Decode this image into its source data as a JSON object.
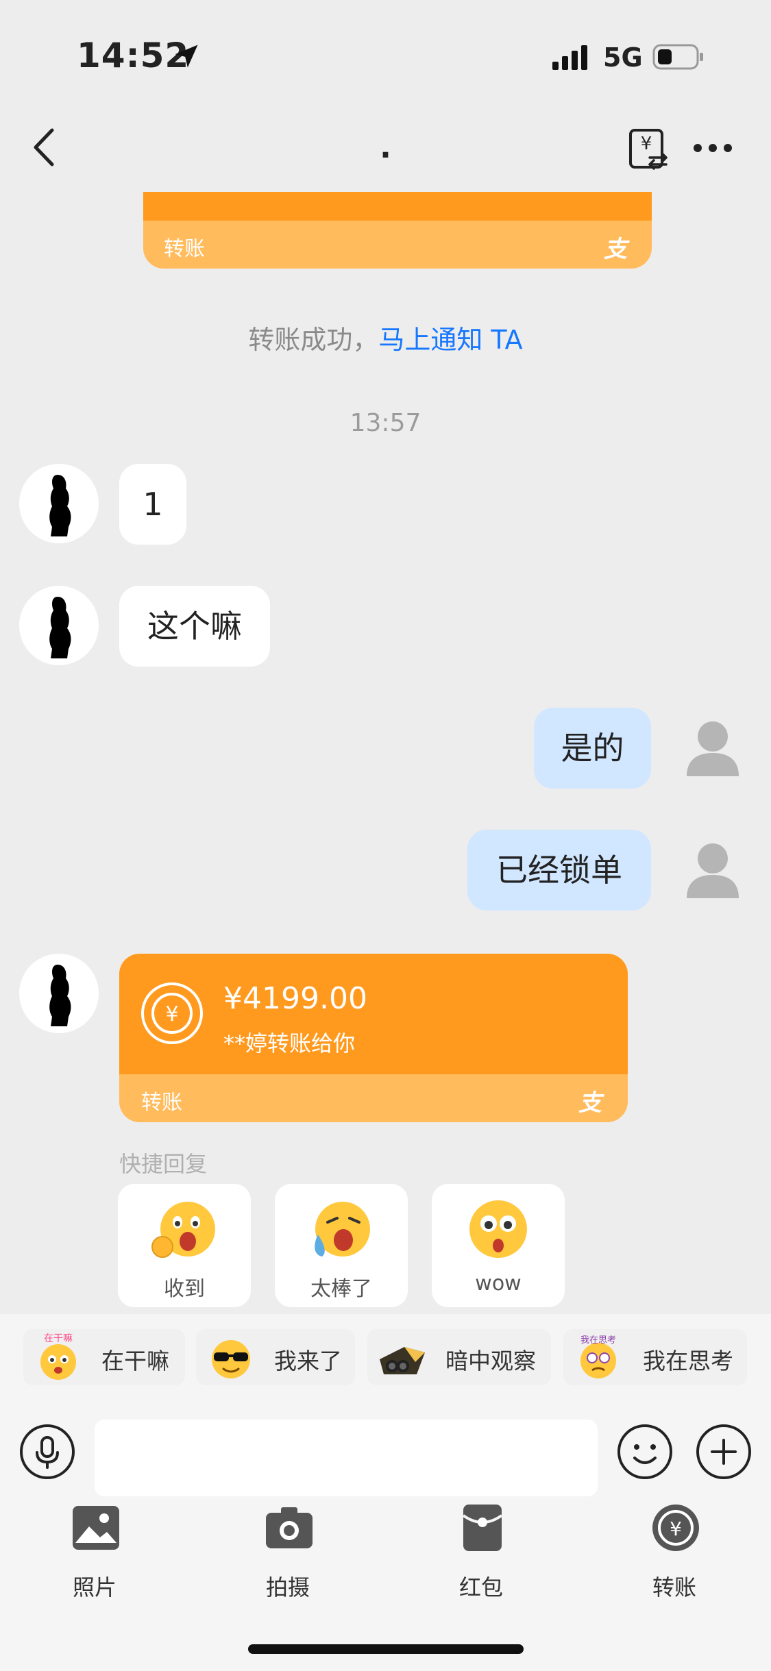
{
  "status_bar": {
    "time": "14:52",
    "network": "5G"
  },
  "nav": {
    "title": "."
  },
  "chat": {
    "top_card": {
      "footer_label": "转账",
      "brand_glyph": "支"
    },
    "system_message": {
      "text": "转账成功，",
      "link": "马上通知 TA"
    },
    "time_divider": "13:57",
    "messages": [
      {
        "side": "in",
        "text": "1"
      },
      {
        "side": "in",
        "text": "这个嘛"
      },
      {
        "side": "out",
        "text": "是的"
      },
      {
        "side": "out",
        "text": "已经锁单"
      }
    ],
    "transfer": {
      "amount": "¥4199.00",
      "note": "**婷转账给你",
      "footer_label": "转账",
      "brand_glyph": "支"
    },
    "quick_reply": {
      "label": "快捷回复",
      "options": [
        {
          "label": "收到",
          "icon": "ok-hand-emoji-icon"
        },
        {
          "label": "太棒了",
          "icon": "crying-laughing-emoji-icon"
        },
        {
          "label": "wow",
          "icon": "surprised-emoji-icon"
        }
      ]
    }
  },
  "stickers": [
    {
      "label": "在干嘛",
      "icon": "waving-emoji-sticker-icon",
      "overlay": "在干嘛"
    },
    {
      "label": "我来了",
      "icon": "sunglasses-emoji-sticker-icon"
    },
    {
      "label": "暗中观察",
      "icon": "peeking-binoculars-sticker-icon"
    },
    {
      "label": "我在思考",
      "icon": "thinking-emoji-sticker-icon",
      "overlay": "我在思考"
    }
  ],
  "input": {
    "placeholder": "",
    "value": ""
  },
  "toolbar": [
    {
      "label": "照片",
      "icon": "photo-icon"
    },
    {
      "label": "拍摄",
      "icon": "camera-icon"
    },
    {
      "label": "红包",
      "icon": "red-packet-icon"
    },
    {
      "label": "转账",
      "icon": "transfer-icon"
    }
  ],
  "colors": {
    "accent_orange": "#ff9a1f",
    "card_footer": "#ffbb5c",
    "link_blue": "#1677ff",
    "outgoing_bubble": "#d1e6ff",
    "background": "#ededed"
  }
}
